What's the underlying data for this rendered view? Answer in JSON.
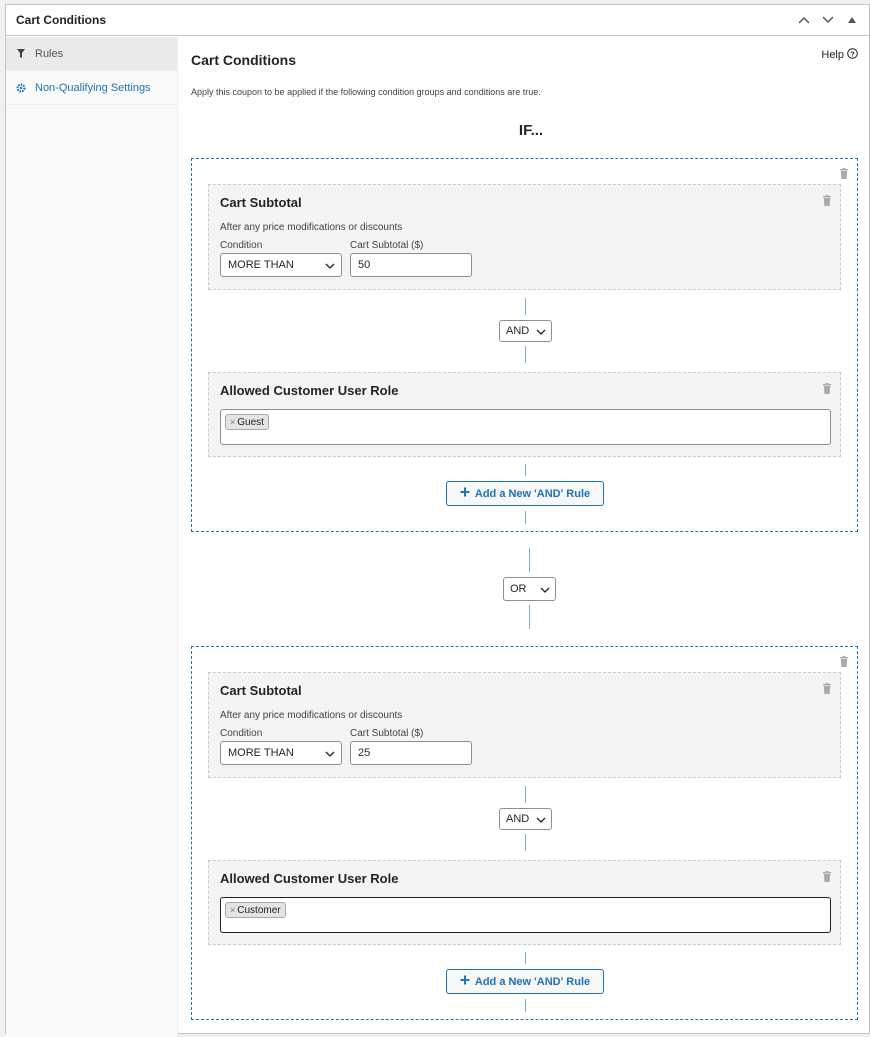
{
  "metabox": {
    "title": "Cart Conditions",
    "handles": [
      "chevron-up-icon",
      "chevron-down-icon",
      "triangle-up-icon"
    ]
  },
  "sidebar": {
    "items": [
      {
        "label": "Rules",
        "icon": "filter-icon",
        "active": true
      },
      {
        "label": "Non-Qualifying Settings",
        "icon": "gear-icon",
        "active": false
      }
    ]
  },
  "main": {
    "title": "Cart Conditions",
    "help_label": "Help",
    "description": "Apply this coupon to be applied if the following condition groups and conditions are true.",
    "if_label": "IF..."
  },
  "groups": [
    {
      "subtotal": {
        "title": "Cart Subtotal",
        "subtitle": "After any price modifications or discounts",
        "condition_label": "Condition",
        "condition_value": "MORE THAN",
        "amount_label": "Cart Subtotal ($)",
        "amount_value": "50"
      },
      "join": "AND",
      "role": {
        "title": "Allowed Customer User Role",
        "tags": [
          "Guest"
        ]
      },
      "add_rule_label": "Add a New 'AND' Rule"
    },
    {
      "subtotal": {
        "title": "Cart Subtotal",
        "subtitle": "After any price modifications or discounts",
        "condition_label": "Condition",
        "condition_value": "MORE THAN",
        "amount_label": "Cart Subtotal ($)",
        "amount_value": "25"
      },
      "join": "AND",
      "role": {
        "title": "Allowed Customer User Role",
        "tags": [
          "Customer"
        ]
      },
      "add_rule_label": "Add a New 'AND' Rule"
    }
  ],
  "group_join": "OR",
  "colors": {
    "accent": "#2271b1",
    "connector": "#72aee6",
    "border": "#c3c4c7"
  }
}
